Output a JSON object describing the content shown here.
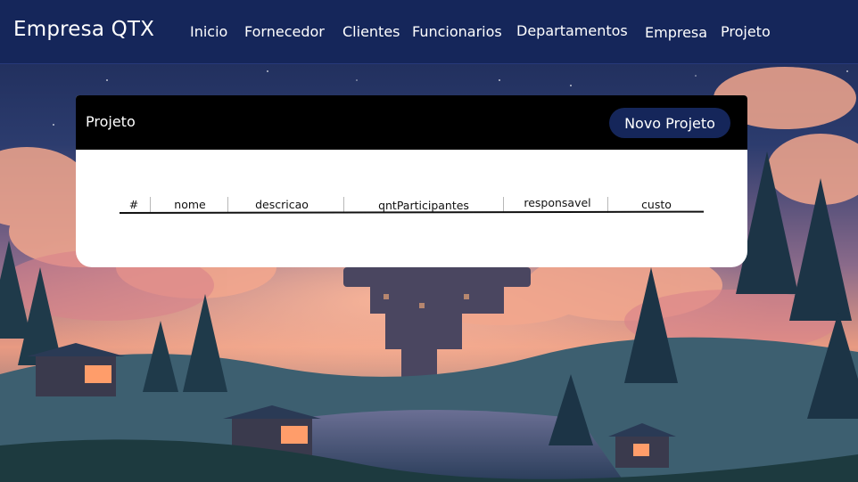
{
  "navbar": {
    "brand": "Empresa QTX",
    "links": [
      "Inicio",
      "Fornecedor",
      "Clientes",
      "Funcionarios",
      "Departamentos",
      "Empresa",
      "Projeto"
    ]
  },
  "card": {
    "title": "Projeto",
    "new_button_label": "Novo Projeto"
  },
  "table": {
    "columns": [
      "#",
      "nome",
      "descricao",
      "qntParticipantes",
      "responsavel",
      "custo"
    ],
    "rows": []
  },
  "colors": {
    "navbar": "#15265a",
    "header": "#000000",
    "button": "#15265a"
  }
}
